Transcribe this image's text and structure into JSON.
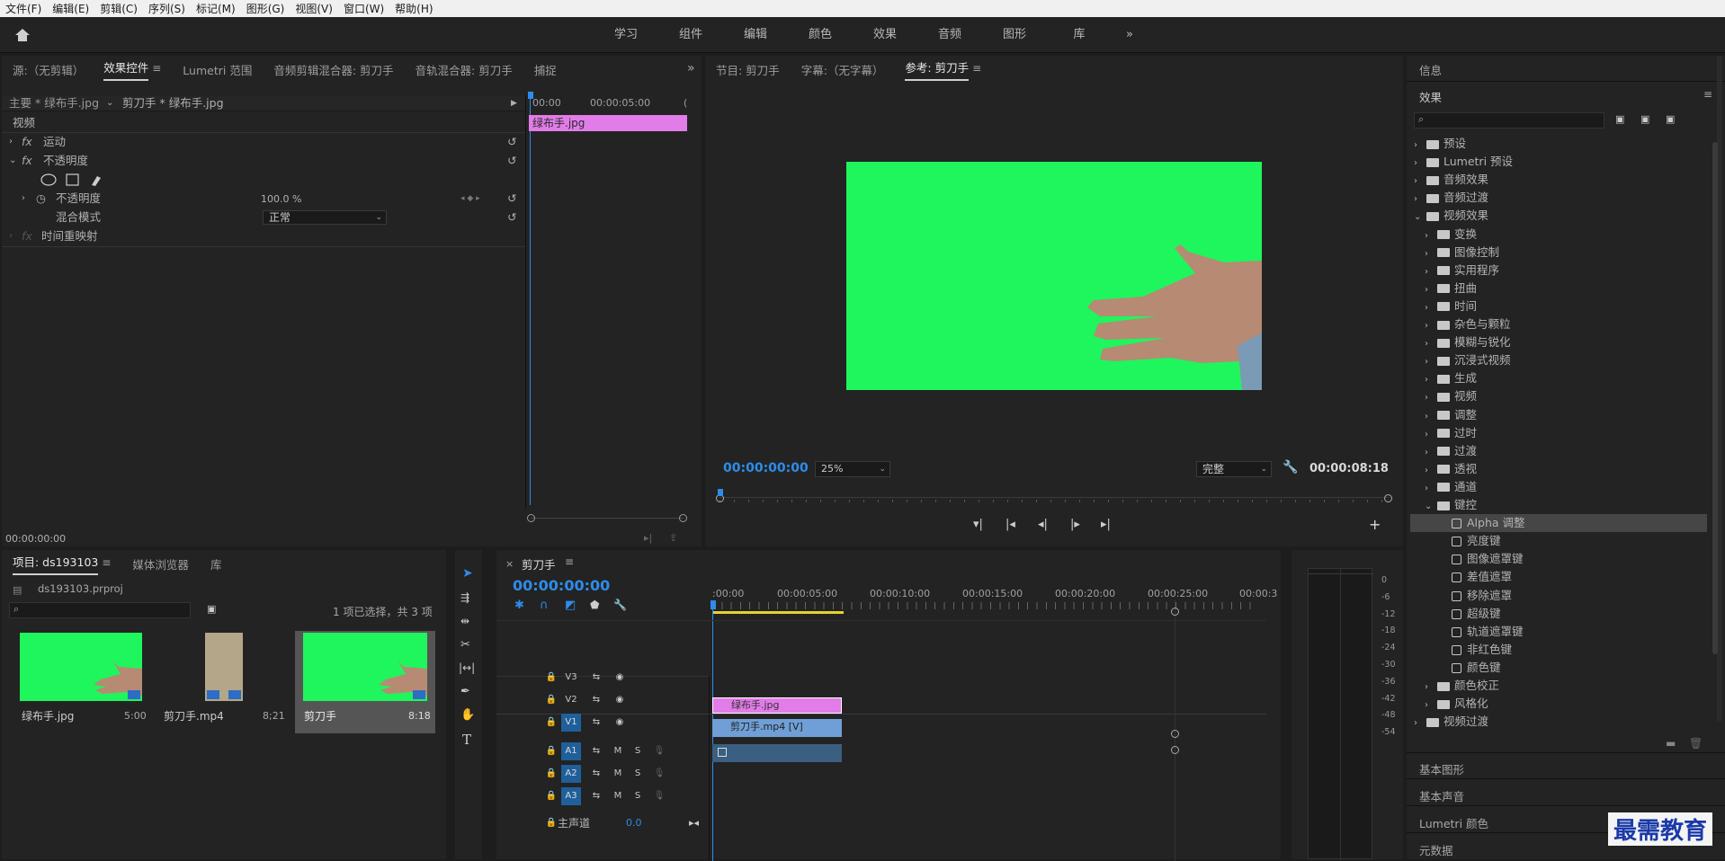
{
  "menu": [
    "文件(F)",
    "编辑(E)",
    "剪辑(C)",
    "序列(S)",
    "标记(M)",
    "图形(G)",
    "视图(V)",
    "窗口(W)",
    "帮助(H)"
  ],
  "workspaces": [
    "学习",
    "组件",
    "编辑",
    "颜色",
    "效果",
    "音频",
    "图形",
    "库"
  ],
  "ws_more": "»",
  "source_tabs": [
    "源:（无剪辑）",
    "效果控件",
    "Lumetri 范围",
    "音频剪辑混合器: 剪刀手",
    "音轨混合器: 剪刀手",
    "捕捉"
  ],
  "ec": {
    "clip_master": "主要 * 绿布手.jpg",
    "clip_seq": "剪刀手 * 绿布手.jpg",
    "section": "视频",
    "motion": "运动",
    "opacity": "不透明度",
    "opacity_prop": "不透明度",
    "opacity_val": "100.0 %",
    "blend_label": "混合模式",
    "blend_val": "正常",
    "time_remap": "时间重映射",
    "ruler": [
      "00:00",
      "00:00:05:00",
      "("
    ],
    "clip": "绿布手.jpg",
    "timecode": "00:00:00:00"
  },
  "program_tabs": [
    "节目: 剪刀手",
    "字幕:（无字幕）",
    "参考: 剪刀手"
  ],
  "program": {
    "tc_left": "00:00:00:00",
    "zoom": "25%",
    "quality": "完整",
    "tc_right": "00:00:08:18"
  },
  "info": "信息",
  "effects": {
    "title": "效果",
    "tree": [
      {
        "label": "预设",
        "lvl": 0,
        "type": "preset"
      },
      {
        "label": "Lumetri 预设",
        "lvl": 0,
        "type": "preset"
      },
      {
        "label": "音频效果",
        "lvl": 0,
        "type": "folder"
      },
      {
        "label": "音频过渡",
        "lvl": 0,
        "type": "folder"
      },
      {
        "label": "视频效果",
        "lvl": 0,
        "type": "folder",
        "open": true
      },
      {
        "label": "变换",
        "lvl": 1,
        "type": "folder"
      },
      {
        "label": "图像控制",
        "lvl": 1,
        "type": "folder"
      },
      {
        "label": "实用程序",
        "lvl": 1,
        "type": "folder"
      },
      {
        "label": "扭曲",
        "lvl": 1,
        "type": "folder"
      },
      {
        "label": "时间",
        "lvl": 1,
        "type": "folder"
      },
      {
        "label": "杂色与颗粒",
        "lvl": 1,
        "type": "folder"
      },
      {
        "label": "模糊与锐化",
        "lvl": 1,
        "type": "folder"
      },
      {
        "label": "沉浸式视频",
        "lvl": 1,
        "type": "folder"
      },
      {
        "label": "生成",
        "lvl": 1,
        "type": "folder"
      },
      {
        "label": "视频",
        "lvl": 1,
        "type": "folder"
      },
      {
        "label": "调整",
        "lvl": 1,
        "type": "folder"
      },
      {
        "label": "过时",
        "lvl": 1,
        "type": "folder"
      },
      {
        "label": "过渡",
        "lvl": 1,
        "type": "folder"
      },
      {
        "label": "透视",
        "lvl": 1,
        "type": "folder"
      },
      {
        "label": "通道",
        "lvl": 1,
        "type": "folder"
      },
      {
        "label": "键控",
        "lvl": 1,
        "type": "folder",
        "open": true
      },
      {
        "label": "Alpha 调整",
        "lvl": 2,
        "type": "fx",
        "sel": true
      },
      {
        "label": "亮度键",
        "lvl": 2,
        "type": "fx"
      },
      {
        "label": "图像遮罩键",
        "lvl": 2,
        "type": "fx"
      },
      {
        "label": "差值遮罩",
        "lvl": 2,
        "type": "fx"
      },
      {
        "label": "移除遮罩",
        "lvl": 2,
        "type": "fx"
      },
      {
        "label": "超级键",
        "lvl": 2,
        "type": "fx"
      },
      {
        "label": "轨道遮罩键",
        "lvl": 2,
        "type": "fx"
      },
      {
        "label": "非红色键",
        "lvl": 2,
        "type": "fx"
      },
      {
        "label": "颜色键",
        "lvl": 2,
        "type": "fx"
      },
      {
        "label": "颜色校正",
        "lvl": 1,
        "type": "folder"
      },
      {
        "label": "风格化",
        "lvl": 1,
        "type": "folder"
      },
      {
        "label": "视频过渡",
        "lvl": 0,
        "type": "folder"
      }
    ]
  },
  "side_panels": [
    "基本图形",
    "基本声音",
    "Lumetri 颜色",
    "元数据"
  ],
  "project": {
    "tabs": [
      "项目: ds193103",
      "媒体浏览器",
      "库"
    ],
    "file": "ds193103.prproj",
    "selection": "1 项已选择，共 3 项",
    "items": [
      {
        "name": "绿布手.jpg",
        "dur": "5:00"
      },
      {
        "name": "剪刀手.mp4",
        "dur": "8;21"
      },
      {
        "name": "剪刀手",
        "dur": "8:18"
      }
    ]
  },
  "timeline": {
    "tab": "剪刀手",
    "tc": "00:00:00:00",
    "ruler": [
      ":00:00",
      "00:00:05:00",
      "00:00:10:00",
      "00:00:15:00",
      "00:00:20:00",
      "00:00:25:00",
      "00:00:3"
    ],
    "video_tracks": [
      "V3",
      "V2",
      "V1"
    ],
    "audio_tracks": [
      "A1",
      "A2",
      "A3"
    ],
    "m": "M",
    "s": "S",
    "master": "主声道",
    "master_val": "0.0",
    "clip_v2": "绿布手.jpg",
    "clip_v1": "剪刀手.mp4 [V]"
  },
  "meter_scale": [
    "0",
    "-6",
    "-12",
    "-18",
    "-24",
    "-30",
    "-36",
    "-42",
    "-48",
    "-54"
  ],
  "watermark": "最需教育"
}
